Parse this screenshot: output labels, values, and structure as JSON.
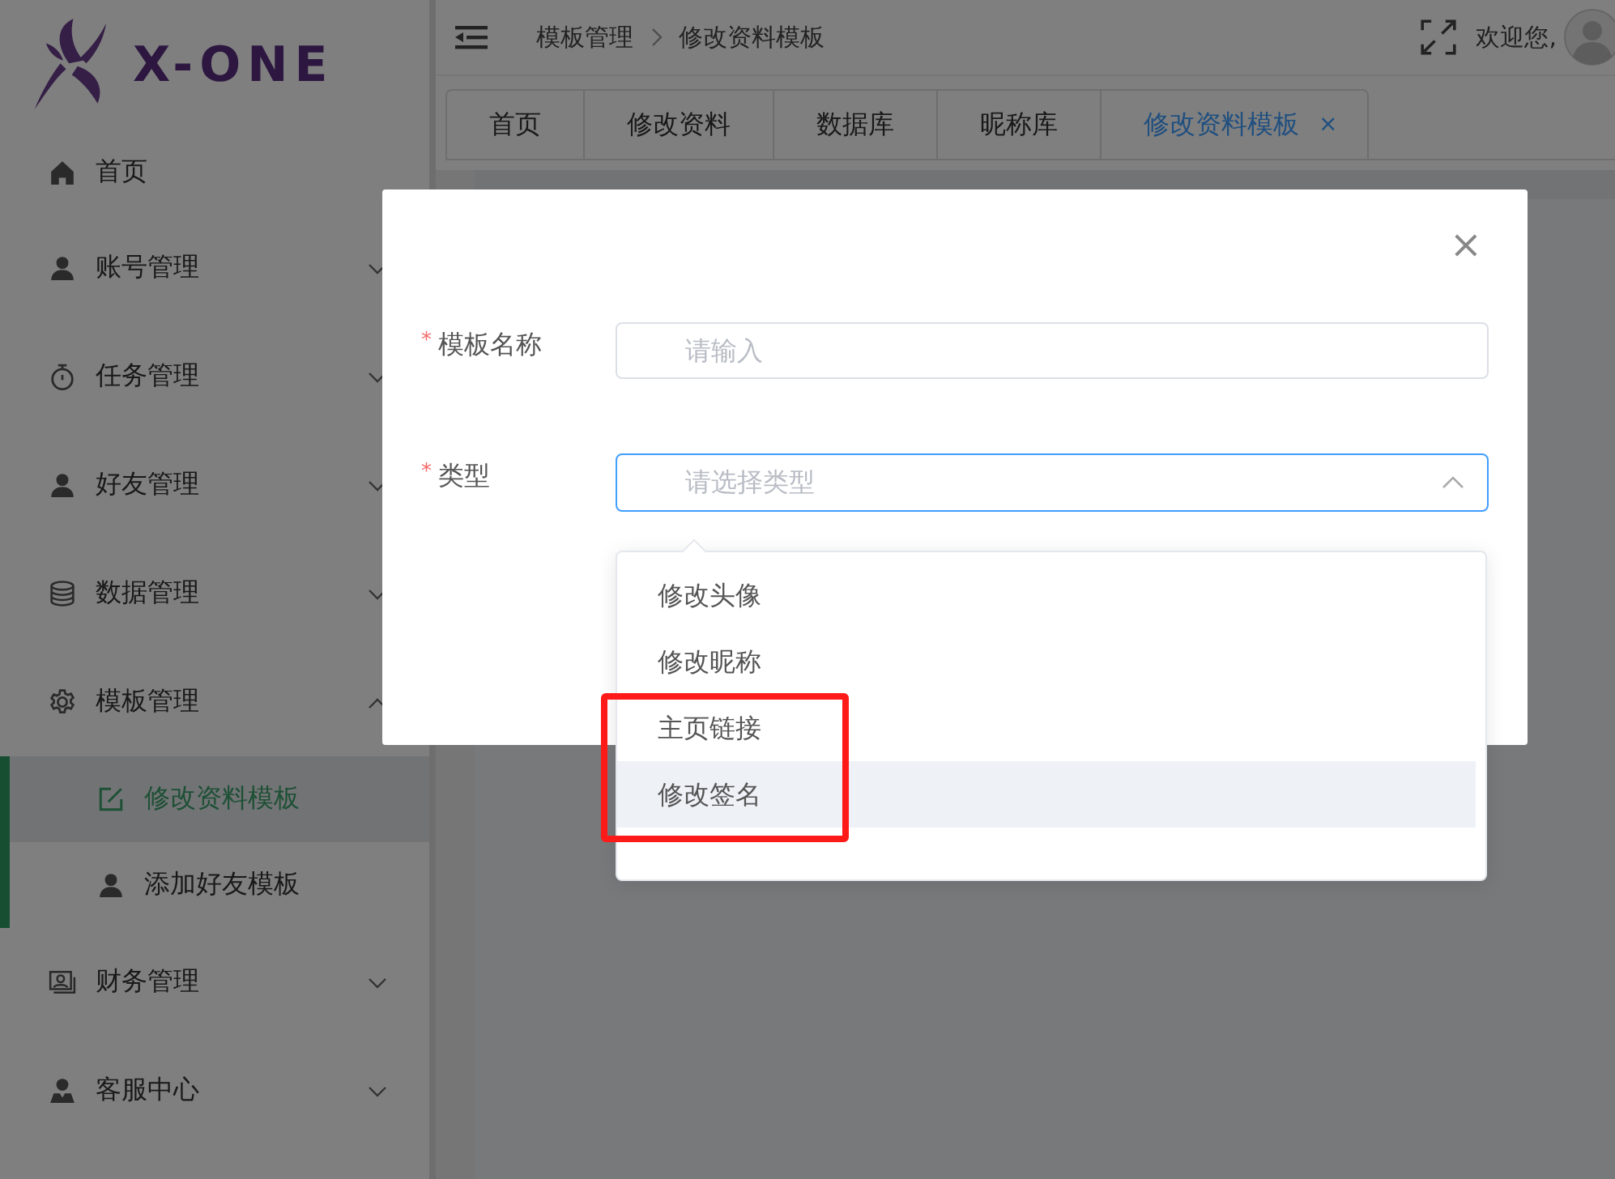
{
  "logo": {
    "text": "X-ONE"
  },
  "header": {
    "breadcrumb": [
      "模板管理",
      "修改资料模板"
    ],
    "welcome": "欢迎您,"
  },
  "tabs": [
    {
      "label": "首页",
      "selected": false
    },
    {
      "label": "修改资料",
      "selected": false
    },
    {
      "label": "数据库",
      "selected": false
    },
    {
      "label": "昵称库",
      "selected": false
    },
    {
      "label": "修改资料模板",
      "selected": true,
      "close": "×"
    }
  ],
  "sidebar": {
    "items": [
      {
        "label": "首页",
        "has_arrow": false
      },
      {
        "label": "账号管理",
        "expanded": false,
        "has_arrow": true
      },
      {
        "label": "任务管理",
        "expanded": false,
        "has_arrow": true
      },
      {
        "label": "好友管理",
        "expanded": false,
        "has_arrow": true
      },
      {
        "label": "数据管理",
        "expanded": false,
        "has_arrow": true
      },
      {
        "label": "模板管理",
        "expanded": true,
        "has_arrow": true,
        "children": [
          {
            "label": "修改资料模板",
            "selected": true
          },
          {
            "label": "添加好友模板",
            "selected": false
          }
        ]
      },
      {
        "label": "财务管理",
        "expanded": false,
        "has_arrow": true
      },
      {
        "label": "客服中心",
        "expanded": false,
        "has_arrow": true
      }
    ]
  },
  "dialog": {
    "close": "×",
    "fields": [
      {
        "label": "模板名称",
        "required_mark": "*",
        "kind": "input",
        "placeholder": "请输入"
      },
      {
        "label": "类型",
        "required_mark": "*",
        "kind": "select",
        "placeholder": "请选择类型",
        "open": true
      }
    ]
  },
  "dropdown": {
    "options": [
      {
        "label": "修改头像",
        "highlighted": false
      },
      {
        "label": "修改昵称",
        "highlighted": false
      },
      {
        "label": "主页链接",
        "highlighted": false
      },
      {
        "label": "修改签名",
        "highlighted": true
      }
    ]
  },
  "annotation": {
    "kind": "box"
  }
}
